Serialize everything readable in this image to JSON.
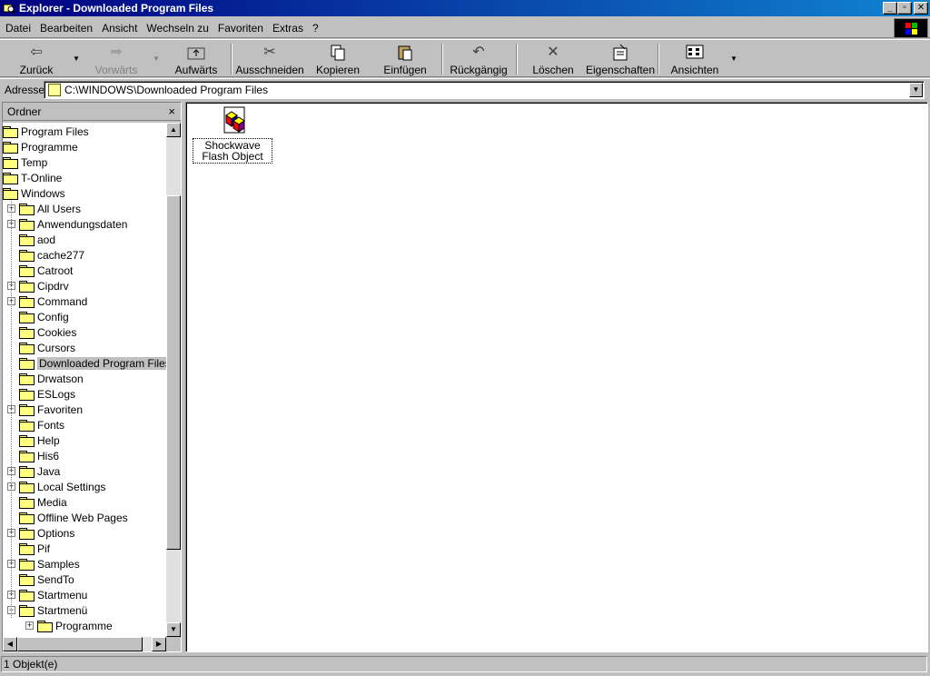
{
  "window": {
    "title": "Explorer - Downloaded Program Files",
    "buttons": [
      "_",
      "▫",
      "✕"
    ]
  },
  "menu": [
    {
      "label": "Datei"
    },
    {
      "label": "Bearbeiten"
    },
    {
      "label": "Ansicht"
    },
    {
      "label": "Wechseln zu"
    },
    {
      "label": "Favoriten"
    },
    {
      "label": "Extras"
    },
    {
      "label": "?"
    }
  ],
  "toolbar": {
    "back": "Zurück",
    "forward": "Vorwärts",
    "up": "Aufwärts",
    "cut": "Ausschneiden",
    "copy": "Kopieren",
    "paste": "Einfügen",
    "undo": "Rückgängig",
    "delete": "Löschen",
    "properties": "Eigenschaften",
    "views": "Ansichten"
  },
  "address": {
    "label": "Adresse",
    "value": "C:\\WINDOWS\\Downloaded Program Files"
  },
  "folders_pane": {
    "title": "Ordner",
    "close": "×"
  },
  "tree": [
    {
      "label": "Program Files",
      "level": 0,
      "expander": ""
    },
    {
      "label": "Programme",
      "level": 0,
      "expander": ""
    },
    {
      "label": "Temp",
      "level": 0,
      "expander": ""
    },
    {
      "label": "T-Online",
      "level": 0,
      "expander": ""
    },
    {
      "label": "Windows",
      "level": 0,
      "expander": ""
    },
    {
      "label": "All Users",
      "level": 1,
      "expander": "+"
    },
    {
      "label": "Anwendungsdaten",
      "level": 1,
      "expander": "+"
    },
    {
      "label": "aod",
      "level": 1,
      "expander": ""
    },
    {
      "label": "cache277",
      "level": 1,
      "expander": ""
    },
    {
      "label": "Catroot",
      "level": 1,
      "expander": ""
    },
    {
      "label": "Cipdrv",
      "level": 1,
      "expander": "+"
    },
    {
      "label": "Command",
      "level": 1,
      "expander": "+"
    },
    {
      "label": "Config",
      "level": 1,
      "expander": ""
    },
    {
      "label": "Cookies",
      "level": 1,
      "expander": ""
    },
    {
      "label": "Cursors",
      "level": 1,
      "expander": ""
    },
    {
      "label": "Downloaded Program Files",
      "level": 1,
      "expander": "",
      "selected": true
    },
    {
      "label": "Drwatson",
      "level": 1,
      "expander": ""
    },
    {
      "label": "ESLogs",
      "level": 1,
      "expander": ""
    },
    {
      "label": "Favoriten",
      "level": 1,
      "expander": "+"
    },
    {
      "label": "Fonts",
      "level": 1,
      "expander": ""
    },
    {
      "label": "Help",
      "level": 1,
      "expander": ""
    },
    {
      "label": "His6",
      "level": 1,
      "expander": ""
    },
    {
      "label": "Java",
      "level": 1,
      "expander": "+"
    },
    {
      "label": "Local Settings",
      "level": 1,
      "expander": "+"
    },
    {
      "label": "Media",
      "level": 1,
      "expander": ""
    },
    {
      "label": "Offline Web Pages",
      "level": 1,
      "expander": ""
    },
    {
      "label": "Options",
      "level": 1,
      "expander": "+"
    },
    {
      "label": "Pif",
      "level": 1,
      "expander": ""
    },
    {
      "label": "Samples",
      "level": 1,
      "expander": "+"
    },
    {
      "label": "SendTo",
      "level": 1,
      "expander": ""
    },
    {
      "label": "Startmenu",
      "level": 1,
      "expander": "+"
    },
    {
      "label": "Startmenü",
      "level": 1,
      "expander": "-"
    },
    {
      "label": "Programme",
      "level": 2,
      "expander": "+"
    }
  ],
  "files": [
    {
      "name": "Shockwave Flash Object"
    }
  ],
  "status": {
    "text": "1 Objekt(e)"
  }
}
